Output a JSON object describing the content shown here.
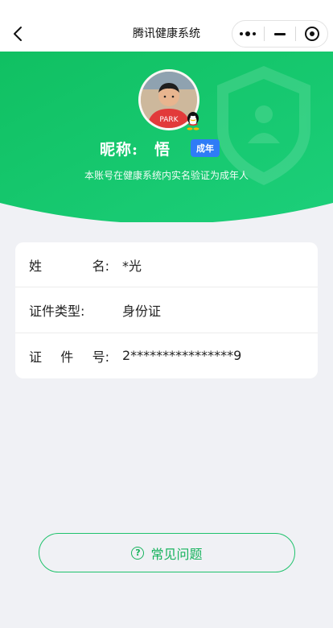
{
  "navbar": {
    "title": "腾讯健康系统",
    "back_icon": "chevron-left-icon",
    "more_icon": "more-dots-icon",
    "minimize_icon": "minimize-icon",
    "close_icon": "target-circle-icon"
  },
  "profile": {
    "nickname": "昵称:　悟",
    "adult_badge": "成年",
    "verify_text": "本账号在健康系统内实名验证为成年人",
    "avatar_icon": "user-avatar",
    "qq_icon": "qq-penguin-icon",
    "shield_icon": "shield-user-icon"
  },
  "info": {
    "rows": [
      {
        "label_chars": [
          "姓",
          "名:"
        ],
        "value": "*光"
      },
      {
        "label_chars": [
          "证件类型:"
        ],
        "value": "身份证"
      },
      {
        "label_chars": [
          "证",
          "件",
          "号:"
        ],
        "value": "2****************9"
      }
    ]
  },
  "faq": {
    "label": "常见问题",
    "icon": "question-circle-icon"
  },
  "colors": {
    "header_green": "#12c165",
    "badge_blue": "#2f7cf6",
    "faq_green": "#18b35e",
    "page_bg": "#f0f1f5"
  }
}
